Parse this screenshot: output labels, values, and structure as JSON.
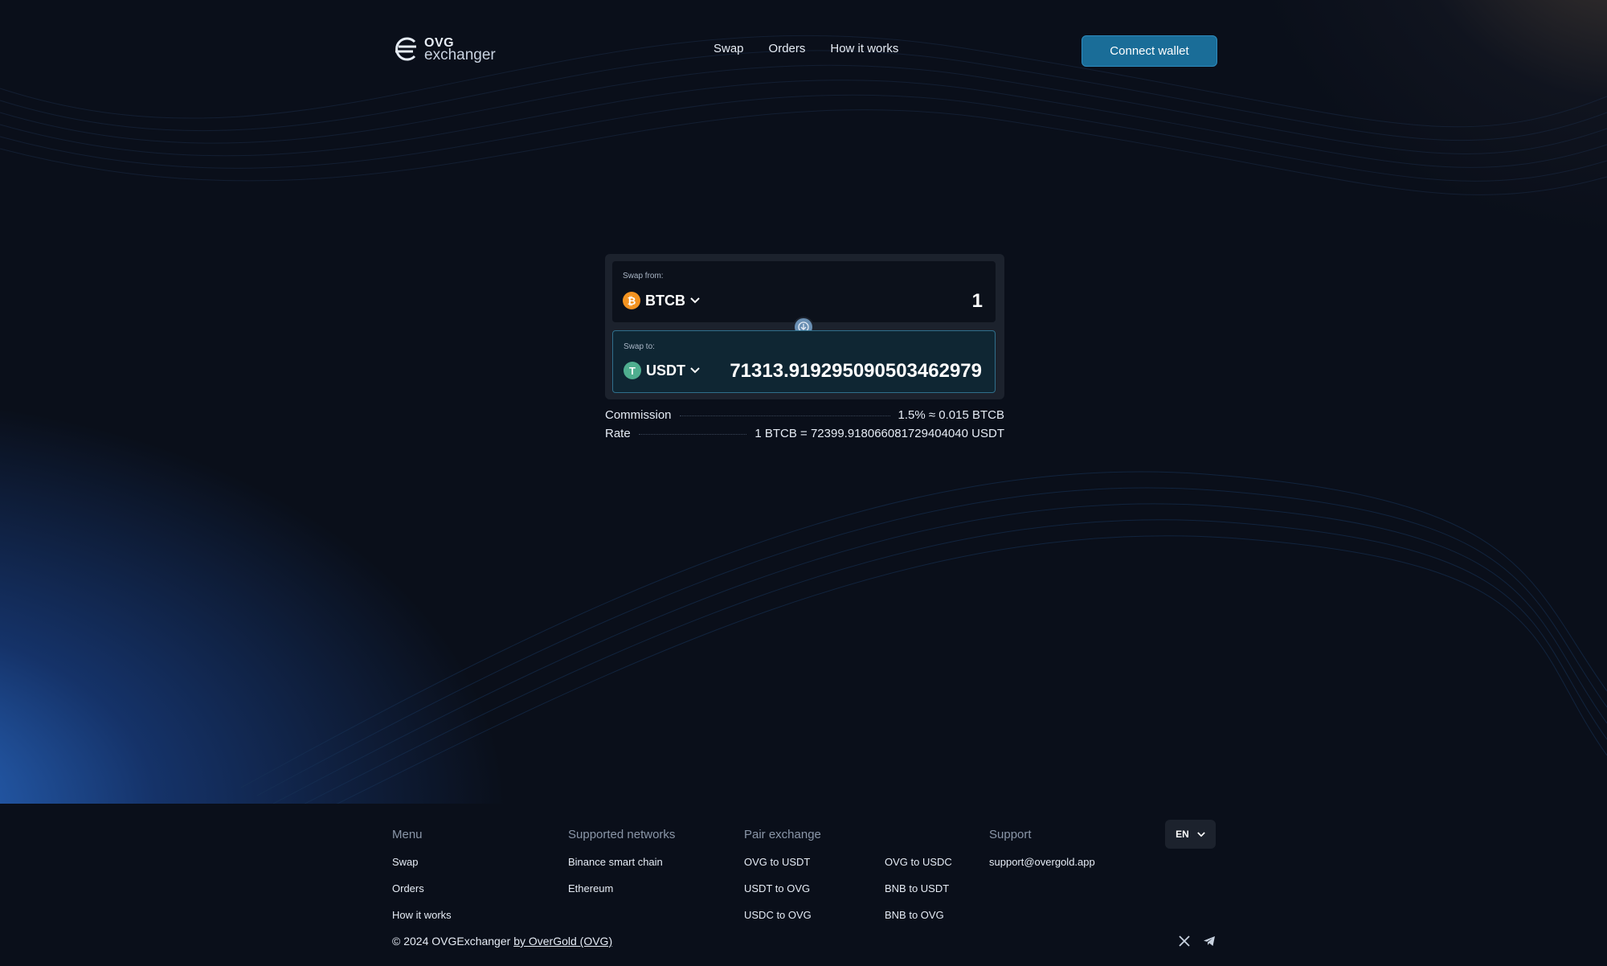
{
  "header": {
    "logo_line1": "OVG",
    "logo_line2": "exchanger",
    "nav": [
      "Swap",
      "Orders",
      "How it works"
    ],
    "connect_label": "Connect wallet"
  },
  "swap": {
    "from_label": "Swap from:",
    "from_token": "BTCB",
    "from_token_icon": "bitcoin-icon",
    "from_amount": "1",
    "to_label": "Swap to:",
    "to_token": "USDT",
    "to_token_icon": "tether-icon",
    "to_amount": "71313.919295090503462979"
  },
  "info": {
    "commission_label": "Commission",
    "commission_value": "1.5% ≈ 0.015 BTCB",
    "rate_label": "Rate",
    "rate_value": "1 BTCB = 72399.918066081729404040 USDT"
  },
  "footer": {
    "menu_heading": "Menu",
    "menu_items": [
      "Swap",
      "Orders",
      "How it works"
    ],
    "networks_heading": "Supported networks",
    "networks": [
      "Binance smart chain",
      "Ethereum"
    ],
    "pairs_heading": "Pair exchange",
    "pairs_col1": [
      "OVG to USDT",
      "USDT to OVG",
      "USDC to OVG"
    ],
    "pairs_col2": [
      "OVG to USDC",
      "BNB to USDT",
      "BNB to OVG"
    ],
    "support_heading": "Support",
    "support_email": "support@overgold.app",
    "language": "EN",
    "copyright_prefix": "© 2024 OVGExchanger",
    "copyright_link": "by OverGold (OVG)"
  },
  "colors": {
    "background": "#0a0f1a",
    "accent": "#1a6d98",
    "card": "#1c222d"
  }
}
